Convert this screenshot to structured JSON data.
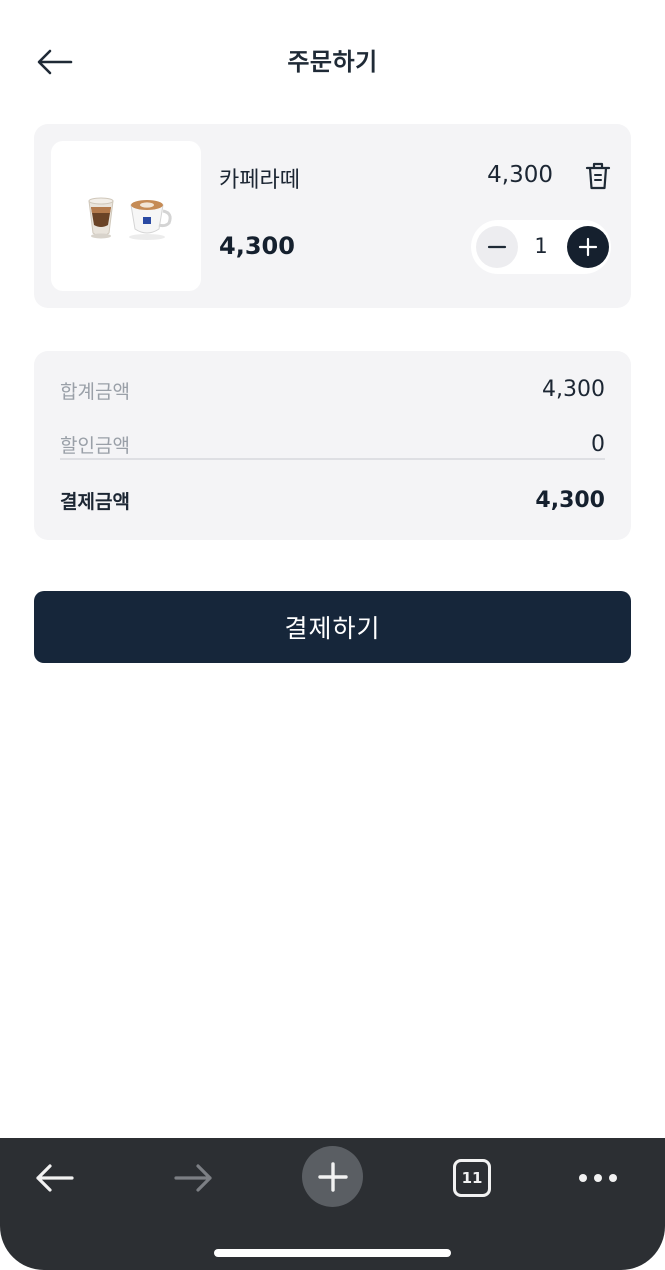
{
  "header": {
    "title": "주문하기"
  },
  "cart_item": {
    "name": "카페라떼",
    "unit_price": "4,300",
    "line_price": "4,300",
    "quantity": "1",
    "image_alt": "coffee cups"
  },
  "summary": {
    "subtotal_label": "합계금액",
    "subtotal_value": "4,300",
    "discount_label": "할인금액",
    "discount_value": "0",
    "total_label": "결제금액",
    "total_value": "4,300"
  },
  "pay_button": {
    "label": "결제하기"
  },
  "browser_toolbar": {
    "tab_count": "11"
  },
  "icons": {
    "back": "arrow-left-icon",
    "trash": "trash-icon",
    "minus": "minus-icon",
    "plus": "plus-icon",
    "forward": "arrow-right-icon",
    "new_tab": "plus-icon",
    "more": "more-dots-icon"
  },
  "colors": {
    "primary": "#16263a",
    "card_bg": "#f4f4f6",
    "muted_text": "#9aa0a8",
    "toolbar_bg": "#2c2f33"
  }
}
